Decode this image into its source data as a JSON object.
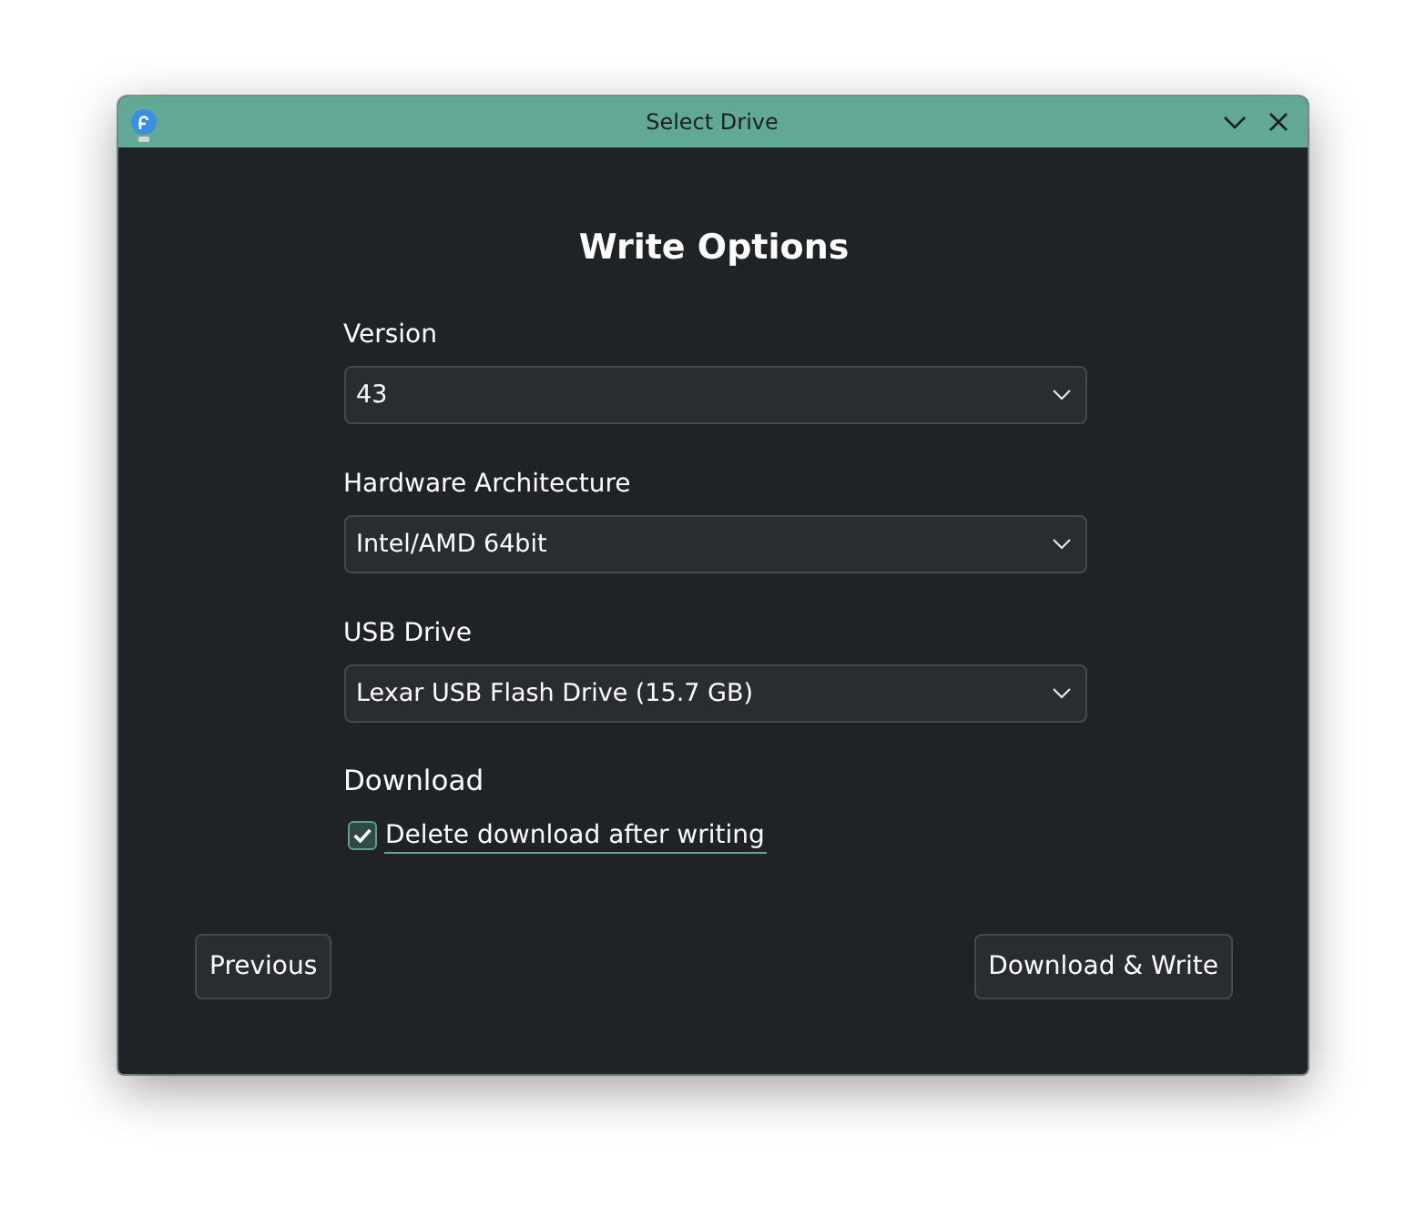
{
  "window": {
    "title": "Select Drive"
  },
  "heading": "Write Options",
  "fields": [
    {
      "label": "Version",
      "value": "43"
    },
    {
      "label": "Hardware Architecture",
      "value": "Intel/AMD 64bit"
    },
    {
      "label": "USB Drive",
      "value": "Lexar USB Flash Drive (15.7 GB)"
    }
  ],
  "download": {
    "heading": "Download",
    "checkbox": {
      "label": "Delete download after writing",
      "checked": true,
      "focused": true
    }
  },
  "buttons": [
    {
      "label": "Previous"
    },
    {
      "label": "Download & Write"
    }
  ]
}
